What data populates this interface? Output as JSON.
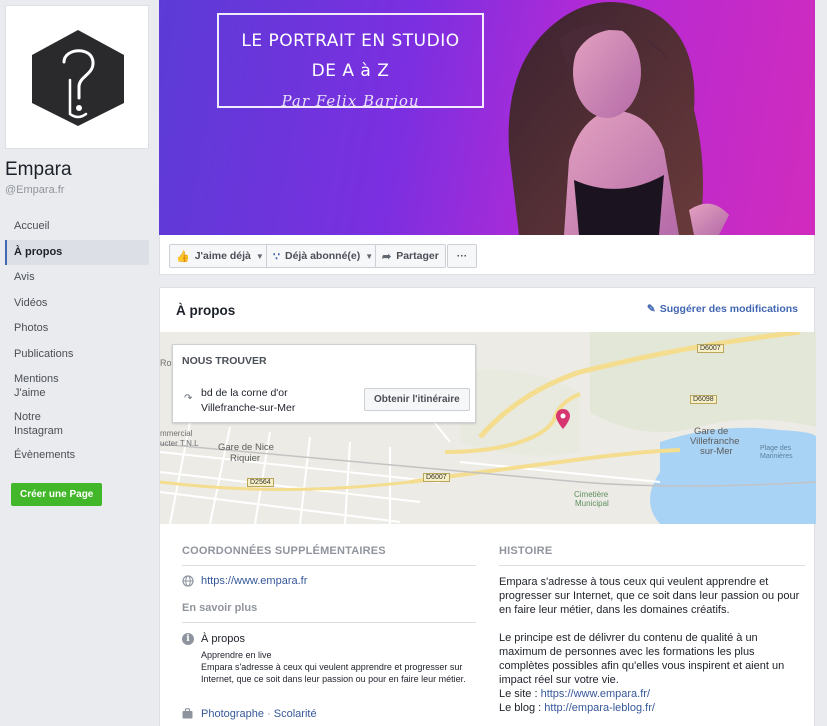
{
  "page": {
    "name": "Empara",
    "handle": "@Empara.fr"
  },
  "nav": {
    "items": [
      {
        "label": "Accueil"
      },
      {
        "label": "À propos"
      },
      {
        "label": "Avis"
      },
      {
        "label": "Vidéos"
      },
      {
        "label": "Photos"
      },
      {
        "label": "Publications"
      },
      {
        "label": "Mentions J'aime"
      },
      {
        "label": "Notre Instagram"
      },
      {
        "label": "Évènements"
      }
    ],
    "active_index": 1,
    "create_page": "Créer une Page"
  },
  "cover": {
    "line1": "LE PORTRAIT EN STUDIO",
    "line2": "DE A à Z",
    "line3": "Par Felix Barjou"
  },
  "actions": {
    "like": "J'aime déjà",
    "follow": "Déjà abonné(e)",
    "share": "Partager",
    "more": "···"
  },
  "about": {
    "title": "À propos",
    "suggest": "Suggérer des modifications",
    "find": {
      "title": "NOUS TROUVER",
      "address_line1": "bd de la corne d'or",
      "address_line2": "Villefranche-sur-Mer",
      "directions": "Obtenir l'itinéraire"
    },
    "map_labels": {
      "gare_nice": "Gare de Nice",
      "riquier": "Riquier",
      "gare_villefranche": "Gare de",
      "villefranche": "Villefranche",
      "sur_mer": "sur-Mer",
      "cimetiere": "Cimetière",
      "municipal": "Municipal",
      "plage": "Plage des",
      "marinieres": "Marinières",
      "d6007_top": "D6007",
      "d6098": "D6098",
      "d6007_bottom": "D6007",
      "d2564": "D2564",
      "left_edge": "Ro",
      "left_edge2": "mmercial",
      "left_edge3": "ucter T.N.L"
    },
    "contacts": {
      "header": "COORDONNÉES SUPPLÉMENTAIRES",
      "website": "https://www.empara.fr",
      "more_header": "En savoir plus",
      "info_title": "À propos",
      "info_sub": "Apprendre en live",
      "info_desc": "Empara s'adresse à ceux qui veulent apprendre et progresser sur Internet, que ce soit dans leur passion ou pour en faire leur métier.",
      "category1": "Photographe",
      "category_sep": " · ",
      "category2": "Scolarité"
    },
    "history": {
      "header": "HISTOIRE",
      "p1": "Empara s'adresse à tous ceux qui veulent apprendre et progresser sur Internet, que ce soit dans leur passion ou pour en faire leur métier, dans les domaines créatifs.",
      "p2": "Le principe est de délivrer du contenu de qualité à un maximum de personnes avec les formations les plus complètes possibles afin qu'elles vous inspirent et aient un impact réel sur votre vie.",
      "site_label": "Le site : ",
      "site_url": "https://www.empara.fr/",
      "blog_label": "Le blog : ",
      "blog_url": "http://empara-leblog.fr/"
    }
  },
  "colors": {
    "accent": "#4267b2",
    "link": "#365899",
    "create_button": "#42b72a",
    "map_pin": "#d6356f"
  },
  "icons": [
    "thumbs-up-icon",
    "rss-icon",
    "share-arrow-icon",
    "pencil-icon",
    "globe-icon",
    "info-icon",
    "briefcase-icon",
    "map-pin-icon",
    "directions-arrow-icon"
  ]
}
